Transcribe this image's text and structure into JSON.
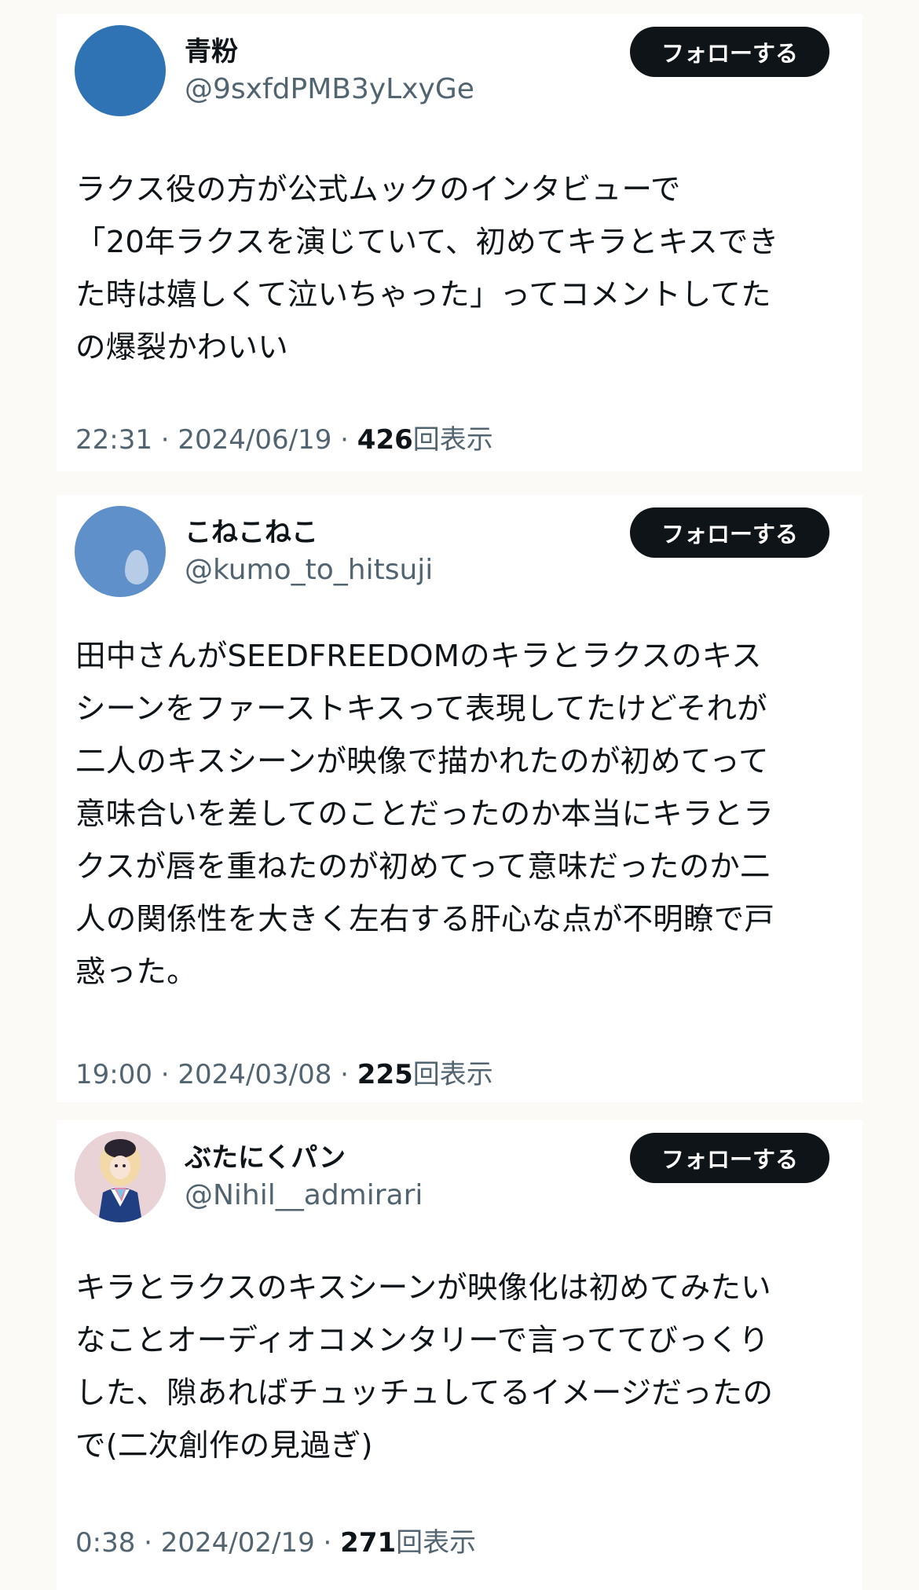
{
  "posts": [
    {
      "name": "青粉",
      "handle": "@9sxfdPMB3yLxyGe",
      "follow_label": "フォローする",
      "text": "ラクス役の方が公式ムックのインタビューで\n「20年ラクスを演じていて、初めてキラとキスでき\nた時は嬉しくて泣いちゃった」ってコメントしてた\nの爆裂かわいい",
      "time": "22:31 · 2024/06/19 · ",
      "views": "426",
      "views_suffix": "回表示"
    },
    {
      "name": "こねこねこ",
      "handle": "@kumo_to_hitsuji",
      "follow_label": "フォローする",
      "text": "田中さんがSEEDFREEDOMのキラとラクスのキス\nシーンをファーストキスって表現してたけどそれが\n二人のキスシーンが映像で描かれたのが初めてって\n意味合いを差してのことだったのか本当にキラとラ\nクスが唇を重ねたのが初めてって意味だったのか二\n人の関係性を大きく左右する肝心な点が不明瞭で戸\n惑った。",
      "time": "19:00 · 2024/03/08 · ",
      "views": "225",
      "views_suffix": "回表示"
    },
    {
      "name": "ぶたにくパン",
      "handle": "@Nihil__admirari",
      "follow_label": "フォローする",
      "text": "キラとラクスのキスシーンが映像化は初めてみたい\nなことオーディオコメンタリーで言っててびっくり\nした、隙あればチュッチュしてるイメージだったの\nで(二次創作の見過ぎ)",
      "time": "0:38 · 2024/02/19 · ",
      "views": "271",
      "views_suffix": "回表示"
    }
  ]
}
